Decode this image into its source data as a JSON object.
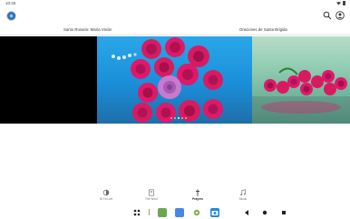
{
  "status_bar": {
    "time": "10:26"
  },
  "sections": [
    {
      "title": "Santo Rosario: María Visión"
    },
    {
      "title": "Oraciones de Santa Brígida"
    }
  ],
  "carousel": {
    "page_count": 5,
    "active_page": 2
  },
  "bottom_nav": {
    "items": [
      {
        "label": "IN Fa Live",
        "icon": "radio-icon",
        "active": false
      },
      {
        "label": "The Word",
        "icon": "book-icon",
        "active": false
      },
      {
        "label": "Prayers",
        "icon": "cross-icon",
        "active": true
      },
      {
        "label": "Music",
        "icon": "music-note-icon",
        "active": false
      }
    ]
  },
  "colors": {
    "center_slide_background": "#1b8ed9",
    "rose_pink": "#e0186a",
    "rose_white": "#c87ad0",
    "right_slide_background": "#8ccab0"
  }
}
